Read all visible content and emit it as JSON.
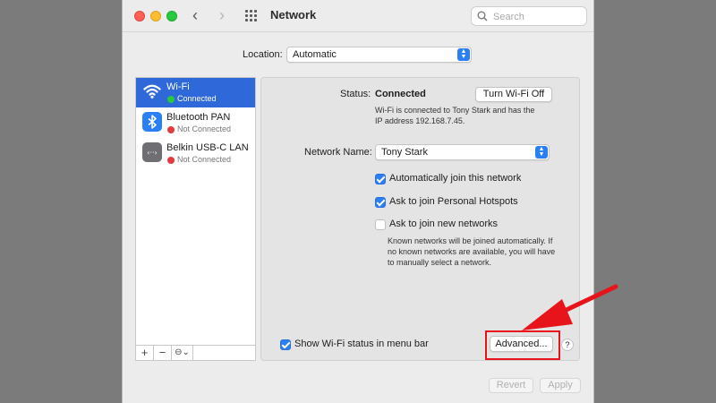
{
  "window": {
    "title": "Network",
    "search_placeholder": "Search"
  },
  "location": {
    "label": "Location:",
    "value": "Automatic"
  },
  "services": [
    {
      "name": "Wi-Fi",
      "status": "Connected",
      "status_color": "#28c840",
      "icon": "wifi-icon",
      "selected": true
    },
    {
      "name": "Bluetooth PAN",
      "status": "Not Connected",
      "status_color": "#e5393d",
      "icon": "bluetooth-icon",
      "selected": false
    },
    {
      "name": "Belkin USB-C LAN",
      "status": "Not Connected",
      "status_color": "#e5393d",
      "icon": "ethernet-icon",
      "selected": false
    }
  ],
  "sidebar_tools": {
    "add": "+",
    "remove": "−",
    "action": "⊖⌄"
  },
  "detail": {
    "status_label": "Status:",
    "status_value": "Connected",
    "turn_off_button": "Turn Wi-Fi Off",
    "status_description_line1": "Wi-Fi is connected to Tony Stark and has the",
    "status_description_line2": "IP address 192.168.7.45.",
    "network_name_label": "Network Name:",
    "network_name_value": "Tony Stark",
    "options": [
      {
        "label": "Automatically join this network",
        "checked": true
      },
      {
        "label": "Ask to join Personal Hotspots",
        "checked": true
      },
      {
        "label": "Ask to join new networks",
        "checked": false
      }
    ],
    "known_networks_line1": "Known networks will be joined automatically. If",
    "known_networks_line2": "no known networks are available, you will have",
    "known_networks_line3": "to manually select a network.",
    "show_status_label": "Show Wi-Fi status in menu bar",
    "show_status_checked": true,
    "advanced_button": "Advanced...",
    "help_button": "?"
  },
  "footer": {
    "revert_button": "Revert",
    "apply_button": "Apply"
  },
  "colors": {
    "accent": "#2a7ff5",
    "selection": "#2f68d9",
    "annotation": "#e8141b"
  }
}
